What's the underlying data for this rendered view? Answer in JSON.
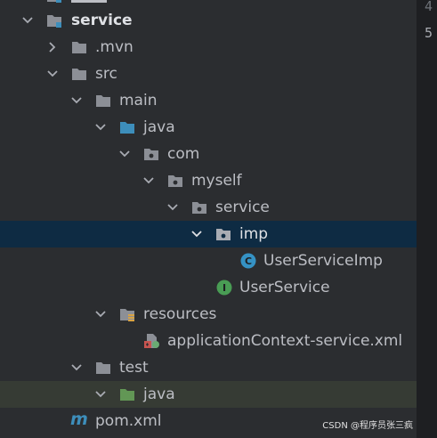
{
  "editor": {
    "line_numbers": [
      "4",
      "5"
    ]
  },
  "tree": {
    "service": {
      "label": "service"
    },
    "mvn": {
      "label": ".mvn"
    },
    "src": {
      "label": "src"
    },
    "main": {
      "label": "main"
    },
    "java": {
      "label": "java"
    },
    "com": {
      "label": "com"
    },
    "myself": {
      "label": "myself"
    },
    "service_pkg": {
      "label": "service"
    },
    "imp": {
      "label": "imp"
    },
    "user_service_imp": {
      "label": "UserServiceImp",
      "icon_letter": "C"
    },
    "user_service": {
      "label": "UserService",
      "icon_letter": "I"
    },
    "resources": {
      "label": "resources"
    },
    "app_context": {
      "label": "applicationContext-service.xml"
    },
    "test": {
      "label": "test"
    },
    "test_java": {
      "label": "java"
    },
    "pom": {
      "label": "pom.xml",
      "icon_letter": "m"
    }
  },
  "colors": {
    "folder": "#8c8f96",
    "source_folder": "#3d8ebb",
    "test_folder": "#629755",
    "class_icon": "#3592c4",
    "interface_icon": "#499c54",
    "selected_row": "#0e2b43"
  },
  "watermark": "CSDN @程序员张三疯"
}
